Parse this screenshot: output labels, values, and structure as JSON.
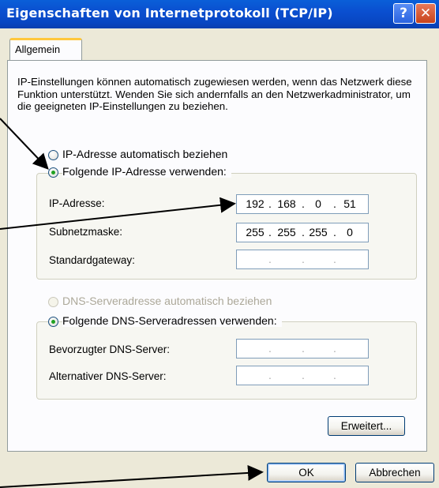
{
  "window": {
    "title": "Eigenschaften von Internetprotokoll (TCP/IP)",
    "help_glyph": "?",
    "close_glyph": "✕"
  },
  "tabs": [
    {
      "label": "Allgemein",
      "active": true
    }
  ],
  "description": "IP-Einstellungen können automatisch zugewiesen werden, wenn das Netzwerk diese Funktion unterstützt. Wenden Sie sich andernfalls an den Netzwerkadministrator, um die geeigneten IP-Einstellungen zu beziehen.",
  "ip_section": {
    "auto_label": "IP-Adresse automatisch beziehen",
    "auto_selected": false,
    "manual_label": "Folgende IP-Adresse verwenden:",
    "manual_selected": true,
    "fields": [
      {
        "label": "IP-Adresse:",
        "octets": [
          "192",
          "168",
          "0",
          "51"
        ]
      },
      {
        "label": "Subnetzmaske:",
        "octets": [
          "255",
          "255",
          "255",
          "0"
        ]
      },
      {
        "label": "Standardgateway:",
        "octets": [
          "",
          "",
          "",
          ""
        ]
      }
    ]
  },
  "dns_section": {
    "auto_label": "DNS-Serveradresse automatisch beziehen",
    "auto_enabled": false,
    "manual_label": "Folgende DNS-Serveradressen verwenden:",
    "manual_selected": true,
    "fields": [
      {
        "label": "Bevorzugter DNS-Server:",
        "octets": [
          "",
          "",
          "",
          ""
        ]
      },
      {
        "label": "Alternativer DNS-Server:",
        "octets": [
          "",
          "",
          "",
          ""
        ]
      }
    ]
  },
  "buttons": {
    "advanced": "Erweitert...",
    "ok": "OK",
    "cancel": "Abbrechen"
  },
  "colors": {
    "titlebar": "#0a4fd0",
    "dialog_bg": "#ece9d8",
    "tab_highlight": "#ffc73c",
    "radio_dot": "#21a121",
    "annotation_arrows": "#000000"
  }
}
